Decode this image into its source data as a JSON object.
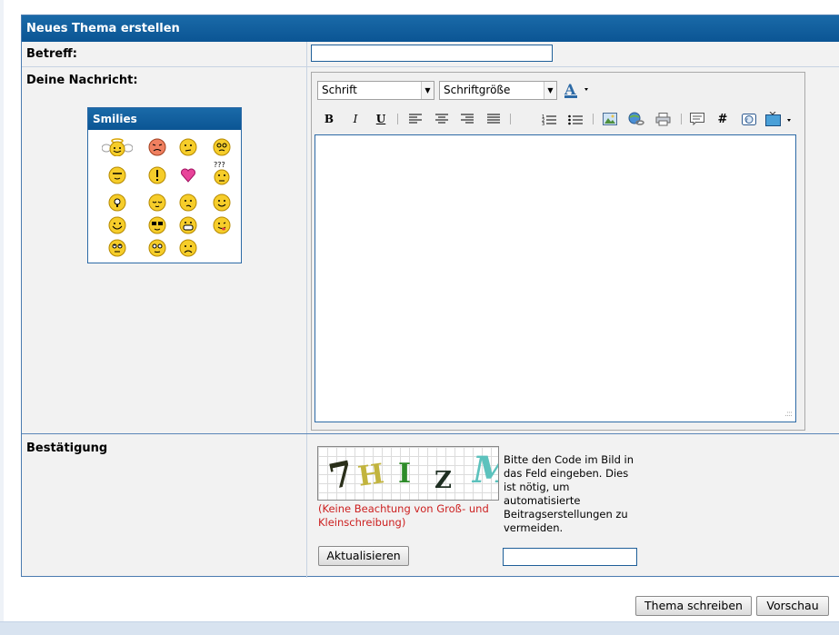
{
  "form": {
    "title": "Neues Thema erstellen",
    "subject_label": "Betreff:",
    "subject_value": "",
    "message_label": "Deine Nachricht:",
    "confirm_label": "Bestätigung"
  },
  "smilies": {
    "title": "Smilies",
    "items": [
      "angel",
      "angry",
      "confused",
      "dizzy",
      "cool",
      "exclamation",
      "heart",
      "question",
      "idea",
      "sleepy",
      "thinking",
      "smile",
      "happy",
      "shades",
      "grin",
      "tongue",
      "rolleyes",
      "blush",
      "sad"
    ]
  },
  "editor": {
    "font_select": "Schrift",
    "size_select": "Schriftgröße",
    "toolbar": {
      "bold": "B",
      "italic": "I",
      "underline": "U",
      "code": "#"
    },
    "body": ""
  },
  "captcha": {
    "chars": [
      "7",
      "H",
      "I",
      "Z",
      "M"
    ],
    "case_hint": "(Keine Beachtung von Groß- und Kleinschreibung)",
    "description": "Bitte den Code im Bild in das Feld eingeben. Dies ist nötig, um automatisierte Beitragserstellungen zu vermeiden.",
    "refresh_label": "Aktualisieren",
    "code_value": ""
  },
  "actions": {
    "submit_label": "Thema schreiben",
    "preview_label": "Vorschau"
  },
  "colors": {
    "header": "#0b5594",
    "accent": "#1f5f99",
    "hint_red": "#cc1f1f"
  }
}
